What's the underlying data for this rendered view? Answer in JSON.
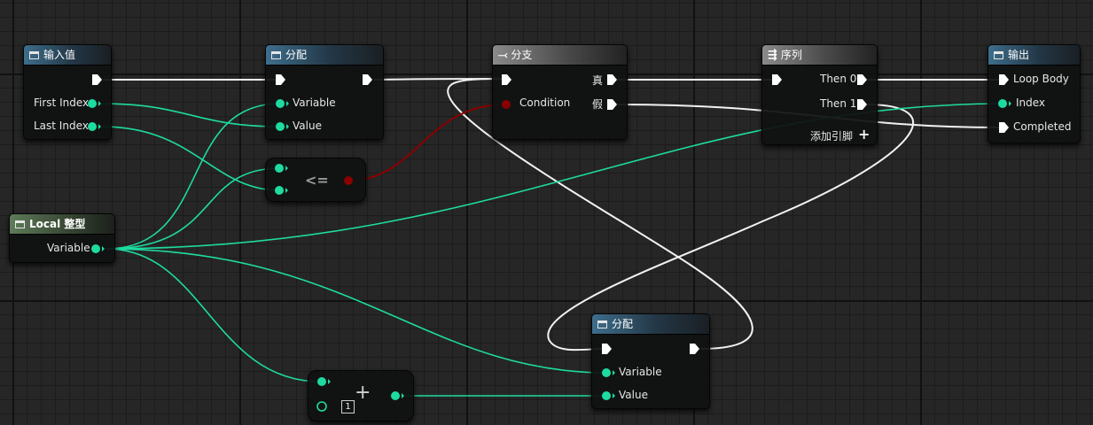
{
  "nodes": {
    "input": {
      "title": "输入值",
      "pins": {
        "first_index": "First Index",
        "last_index": "Last Index"
      }
    },
    "assign1": {
      "title": "分配",
      "pins": {
        "variable": "Variable",
        "value": "Value"
      }
    },
    "compare": {
      "op": "<="
    },
    "branch": {
      "title": "分支",
      "pins": {
        "condition": "Condition",
        "true": "真",
        "false": "假"
      }
    },
    "sequence": {
      "title": "序列",
      "pins": {
        "then0": "Then 0",
        "then1": "Then 1",
        "add_pin": "添加引脚"
      }
    },
    "output": {
      "title": "输出",
      "pins": {
        "loop_body": "Loop Body",
        "index": "Index",
        "completed": "Completed"
      }
    },
    "local": {
      "title": "Local 整型",
      "pins": {
        "variable": "Variable"
      }
    },
    "assign2": {
      "title": "分配",
      "pins": {
        "variable": "Variable",
        "value": "Value"
      }
    },
    "add": {
      "literal": "1",
      "op": "+"
    }
  },
  "colors": {
    "exec": "#ffffff",
    "integer": "#1edba0",
    "boolean": "#8a0000",
    "background": "#262626"
  }
}
